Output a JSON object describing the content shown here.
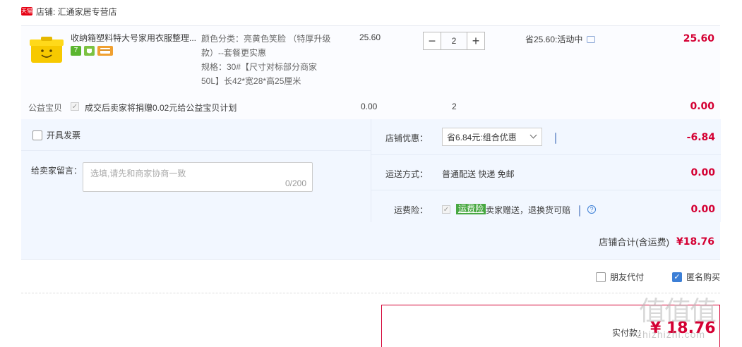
{
  "shop": {
    "badge": "天猫",
    "name": "店铺: 汇通家居专营店"
  },
  "item": {
    "title": "收纳箱塑料特大号家用衣服整理...",
    "badges": [
      "7",
      "",
      ""
    ],
    "sku_color": "颜色分类：亮黄色笑脸 （特厚升级款）--套餐更实惠",
    "sku_spec": "规格：30#【尺寸对标部分商家50L】长42*宽28*高25厘米",
    "unit_price": "25.60",
    "qty_minus": "−",
    "quantity": "2",
    "qty_plus": "+",
    "promo": "省25.60:活动中",
    "total": "25.60"
  },
  "charity": {
    "label": "公益宝贝",
    "text": "成交后卖家将捐赠0.02元给公益宝贝计划",
    "price": "0.00",
    "qty": "2",
    "total": "0.00"
  },
  "invoice": {
    "label": "开具发票"
  },
  "message": {
    "label": "给卖家留言：",
    "placeholder": "选填,请先和商家协商一致",
    "counter": "0/200"
  },
  "discount": {
    "label": "店铺优惠：",
    "selected": "省6.84元:组合优惠",
    "amount": "-6.84"
  },
  "shipping": {
    "label": "运送方式：",
    "method": "普通配送 快递 免邮",
    "amount": "0.00"
  },
  "insurance": {
    "label": "运费险：",
    "tag": "运费险",
    "text": "卖家赠送，退换货可赔",
    "help": "?",
    "amount": "0.00"
  },
  "shop_total": {
    "label": "店铺合计(含运费)",
    "amount": "¥18.76"
  },
  "options": {
    "friend_pay": "朋友代付",
    "anonymous": "匿名购买"
  },
  "payment": {
    "label": "实付款：",
    "amount": "¥ 18.76"
  },
  "watermark": {
    "big": "值值值",
    "small": "zhizhizhi.com"
  },
  "colors": {
    "accent": "#d40033",
    "bg_option": "#f2f7ff",
    "check_blue": "#3c7fd6",
    "tag_green": "#48a842"
  }
}
